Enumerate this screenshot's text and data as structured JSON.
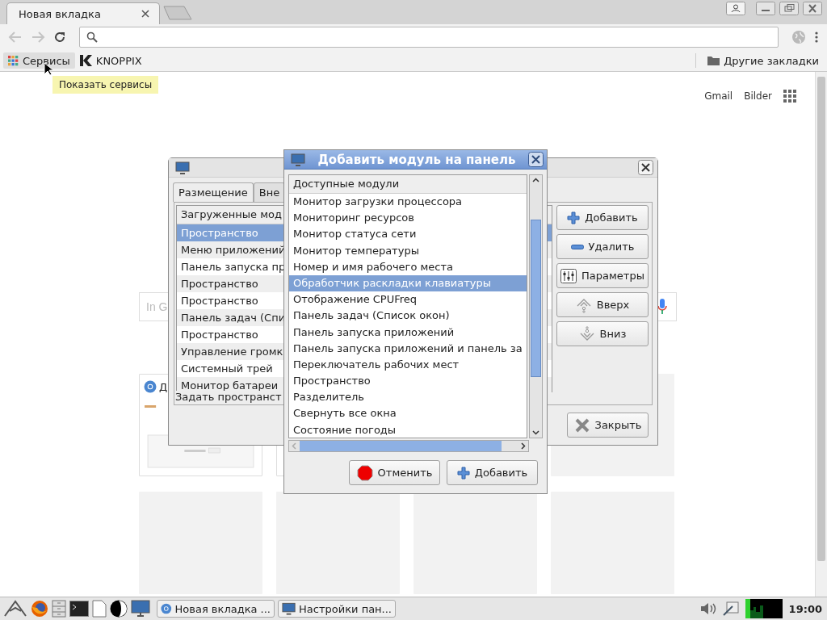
{
  "browser": {
    "tabs": [
      {
        "title": "Новая вкладка",
        "selected": true
      }
    ],
    "bookmarks": [
      {
        "label": "Сервисы",
        "kind": "apps"
      },
      {
        "label": "KNOPPIX",
        "kind": "site"
      }
    ],
    "other_bookmarks": "Другие закладки",
    "tooltip": "Показать сервисы"
  },
  "page": {
    "top_links": [
      "Gmail",
      "Bilder"
    ],
    "search": {
      "placeholder": "In G"
    },
    "tiles": [
      {
        "kind": "site",
        "title": "Д"
      },
      {
        "kind": "site"
      },
      {
        "kind": "empty"
      },
      {
        "kind": "empty"
      },
      {
        "kind": "empty"
      },
      {
        "kind": "empty"
      },
      {
        "kind": "empty"
      }
    ]
  },
  "panel_settings": {
    "tabs": [
      {
        "label": "Размещение",
        "selected": true
      },
      {
        "label": "Вне",
        "selected": false
      }
    ],
    "list": {
      "header": "Загруженные мод",
      "rows": [
        {
          "label": "Пространство",
          "selected": true
        },
        {
          "label": "Меню приложений",
          "selected": false
        },
        {
          "label": "Панель запуска пр",
          "selected": false
        },
        {
          "label": "Пространство",
          "selected": false
        },
        {
          "label": "Пространство",
          "selected": false
        },
        {
          "label": "Панель задач (Спи",
          "selected": false
        },
        {
          "label": "Пространство",
          "selected": false
        },
        {
          "label": "Управление громк",
          "selected": false
        },
        {
          "label": "Системный трей",
          "selected": false
        },
        {
          "label": "Монитор батареи",
          "selected": false
        }
      ]
    },
    "footer_text": "Задать пространст",
    "buttons": [
      {
        "label": "Добавить",
        "kind": "add"
      },
      {
        "label": "Удалить",
        "kind": "remove"
      },
      {
        "label": "Параметры",
        "kind": "prefs"
      },
      {
        "label": "Вверх",
        "kind": "up"
      },
      {
        "label": "Вниз",
        "kind": "down"
      }
    ],
    "close_button": "Закрыть"
  },
  "add_module_dialog": {
    "title": "Добавить модуль на панель",
    "list": {
      "header": "Доступные модули",
      "rows": [
        {
          "label": "Монитор загрузки процессора",
          "selected": false
        },
        {
          "label": "Мониторинг ресурсов",
          "selected": false
        },
        {
          "label": "Монитор статуса сети",
          "selected": false
        },
        {
          "label": "Монитор температуры",
          "selected": false
        },
        {
          "label": "Номер и имя рабочего места",
          "selected": false
        },
        {
          "label": "Обработчик раскладки клавиатуры",
          "selected": true
        },
        {
          "label": "Отображение CPUFreq",
          "selected": false
        },
        {
          "label": "Панель задач (Список окон)",
          "selected": false
        },
        {
          "label": "Панель запуска приложений",
          "selected": false
        },
        {
          "label": "Панель запуска приложений и панель за",
          "selected": false
        },
        {
          "label": "Переключатель рабочих мест",
          "selected": false
        },
        {
          "label": "Пространство",
          "selected": false
        },
        {
          "label": "Разделитель",
          "selected": false
        },
        {
          "label": "Свернуть все окна",
          "selected": false
        },
        {
          "label": "Состояние погоды",
          "selected": false
        }
      ]
    },
    "buttons": [
      {
        "label": "Отменить",
        "kind": "cancel"
      },
      {
        "label": "Добавить",
        "kind": "add"
      }
    ]
  },
  "taskbar": {
    "launchers": [
      {
        "kind": "menu"
      },
      {
        "kind": "firefox"
      },
      {
        "kind": "files"
      },
      {
        "kind": "terminal"
      },
      {
        "kind": "document"
      },
      {
        "kind": "circle"
      },
      {
        "kind": "desktop"
      }
    ],
    "tasks": [
      {
        "label": "Новая вкладка ...",
        "kind": "browser"
      },
      {
        "label": "Настройки пан...",
        "kind": "settings"
      }
    ],
    "clock": "19:00"
  }
}
